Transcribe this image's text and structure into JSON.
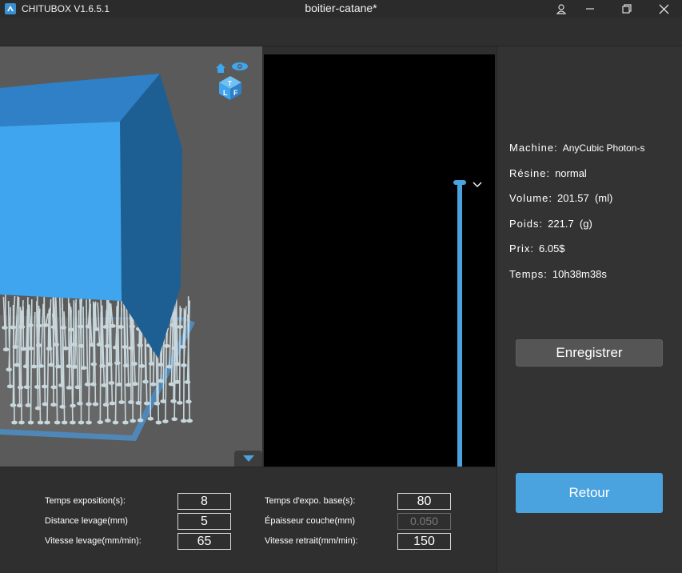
{
  "window": {
    "app_name": "CHITUBOX V1.6.5.1",
    "document_title": "boitier-catane*"
  },
  "viewport": {
    "view_cube_icon": "view-cube-icon",
    "collapse_icon": "triangle-down-icon"
  },
  "info": {
    "machine_label": "Machine:",
    "machine_value": "AnyCubic Photon-s",
    "resin_label": "Résine:",
    "resin_value": "normal",
    "volume_label": "Volume:",
    "volume_value": "201.57  (ml)",
    "weight_label": "Poids:",
    "weight_value": "221.7  (g)",
    "price_label": "Prix:",
    "price_value": "6.05$",
    "time_label": "Temps:",
    "time_value": "10h38m38s"
  },
  "buttons": {
    "save_label": "Enregistrer",
    "back_label": "Retour"
  },
  "settings": {
    "exposure_time_label": "Temps exposition(s):",
    "exposure_time_value": "8",
    "base_exposure_label": "Temps d'expo. base(s):",
    "base_exposure_value": "80",
    "lift_distance_label": "Distance levage(mm)",
    "lift_distance_value": "5",
    "layer_thickness_label": "Épaisseur couche(mm)",
    "layer_thickness_value": "0.050",
    "lift_speed_label": "Vitesse levage(mm/min):",
    "lift_speed_value": "65",
    "retract_speed_label": "Vitesse retrait(mm/min):",
    "retract_speed_value": "150"
  },
  "colors": {
    "accent": "#4aa3df",
    "model_front": "#3fa5ee",
    "model_top": "#2f80c6",
    "model_side": "#1e5f93",
    "background": "#2f2f2f"
  }
}
